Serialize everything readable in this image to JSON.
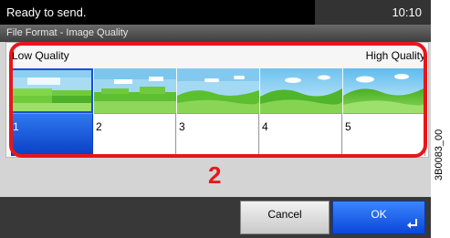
{
  "status_bar": {
    "message": "Ready to send.",
    "time": "10:10"
  },
  "title_bar": {
    "title": "File Format - Image Quality"
  },
  "quality_scale": {
    "low_label": "Low Quality",
    "high_label": "High Quality"
  },
  "quality_options": [
    {
      "number": "1",
      "selected": true
    },
    {
      "number": "2",
      "selected": false
    },
    {
      "number": "3",
      "selected": false
    },
    {
      "number": "4",
      "selected": false
    },
    {
      "number": "5",
      "selected": false
    }
  ],
  "callout_number": "2",
  "footer": {
    "cancel_label": "Cancel",
    "ok_label": "OK"
  },
  "figure_code": "3B0083_00",
  "colors": {
    "selection_blue": "#1b5be6",
    "highlight_red": "#e8161b"
  }
}
